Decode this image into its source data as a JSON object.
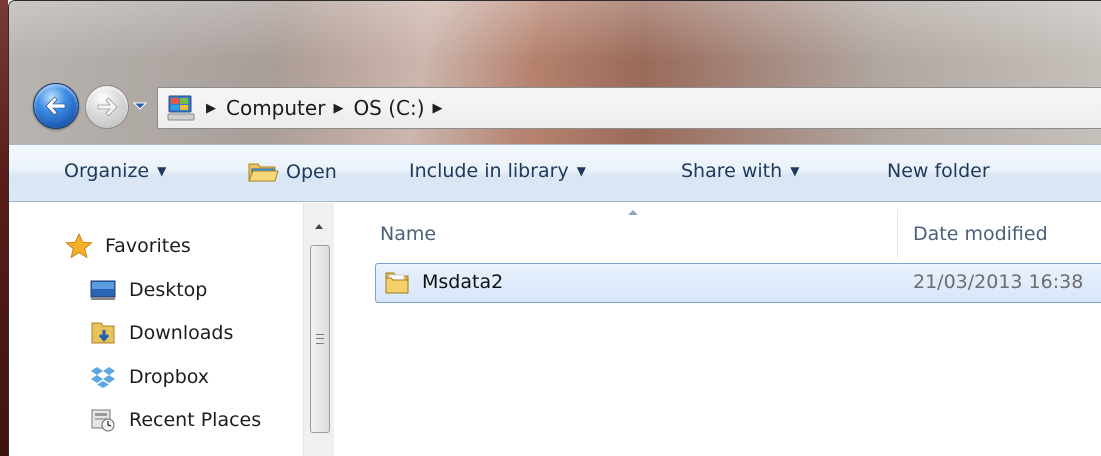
{
  "address_bar": {
    "breadcrumbs": [
      "Computer",
      "OS (C:)"
    ]
  },
  "command_bar": {
    "organize": "Organize",
    "open": "Open",
    "include_in_library": "Include in library",
    "share_with": "Share with",
    "new_folder": "New folder"
  },
  "navigation_pane": {
    "favorites": "Favorites",
    "items": [
      {
        "label": "Desktop",
        "icon": "desktop-icon"
      },
      {
        "label": "Downloads",
        "icon": "downloads-icon"
      },
      {
        "label": "Dropbox",
        "icon": "dropbox-icon"
      },
      {
        "label": "Recent Places",
        "icon": "recent-places-icon"
      }
    ]
  },
  "file_list": {
    "columns": {
      "name": "Name",
      "date_modified": "Date modified"
    },
    "rows": [
      {
        "name": "Msdata2",
        "date_modified": "21/03/2013 16:38",
        "icon": "folder-icon"
      }
    ]
  },
  "colors": {
    "selection_border": "#7da2ce",
    "selection_fill": "#d6e6fa",
    "command_text": "#1e395b",
    "header_text": "#4c607a"
  }
}
